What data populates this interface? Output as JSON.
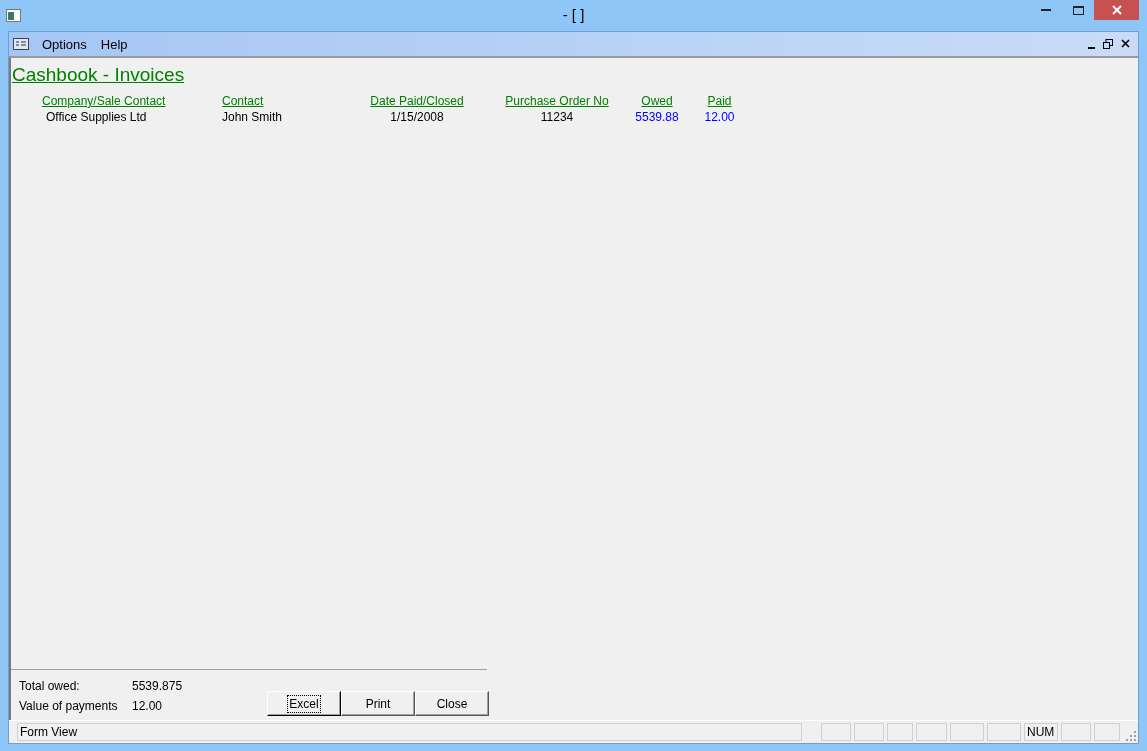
{
  "window": {
    "title": "- [ ]"
  },
  "menu": [
    {
      "label": "Options"
    },
    {
      "label": "Help"
    }
  ],
  "report": {
    "title": "Cashbook - Invoices",
    "columns": [
      {
        "label": "Company/Sale Contact",
        "kind": "text"
      },
      {
        "label": "Contact",
        "kind": "text"
      },
      {
        "label": "Date Paid/Closed",
        "kind": "center"
      },
      {
        "label": "Purchase Order No",
        "kind": "center"
      },
      {
        "label": "Owed",
        "kind": "amount"
      },
      {
        "label": "Paid",
        "kind": "amount"
      }
    ],
    "rows": [
      [
        "Office Supplies Ltd",
        "John Smith",
        "1/15/2008",
        "11234",
        "5539.88",
        "12.00"
      ]
    ]
  },
  "totals": [
    {
      "label": "Total owed:",
      "value": "5539.875"
    },
    {
      "label": "Value of payments",
      "value": "12.00"
    }
  ],
  "buttons": [
    {
      "label": "Excel",
      "focused": true
    },
    {
      "label": "Print",
      "focused": false
    },
    {
      "label": "Close",
      "focused": false
    }
  ],
  "status_bar": {
    "panes": [
      {
        "kind": "text",
        "text": "Form View"
      },
      {
        "kind": "blank"
      },
      {
        "kind": "blank"
      },
      {
        "kind": "blank"
      },
      {
        "kind": "blank"
      },
      {
        "kind": "blank"
      },
      {
        "kind": "blank"
      },
      {
        "kind": "text",
        "text": "NUM"
      },
      {
        "kind": "blank"
      },
      {
        "kind": "blank"
      }
    ]
  }
}
